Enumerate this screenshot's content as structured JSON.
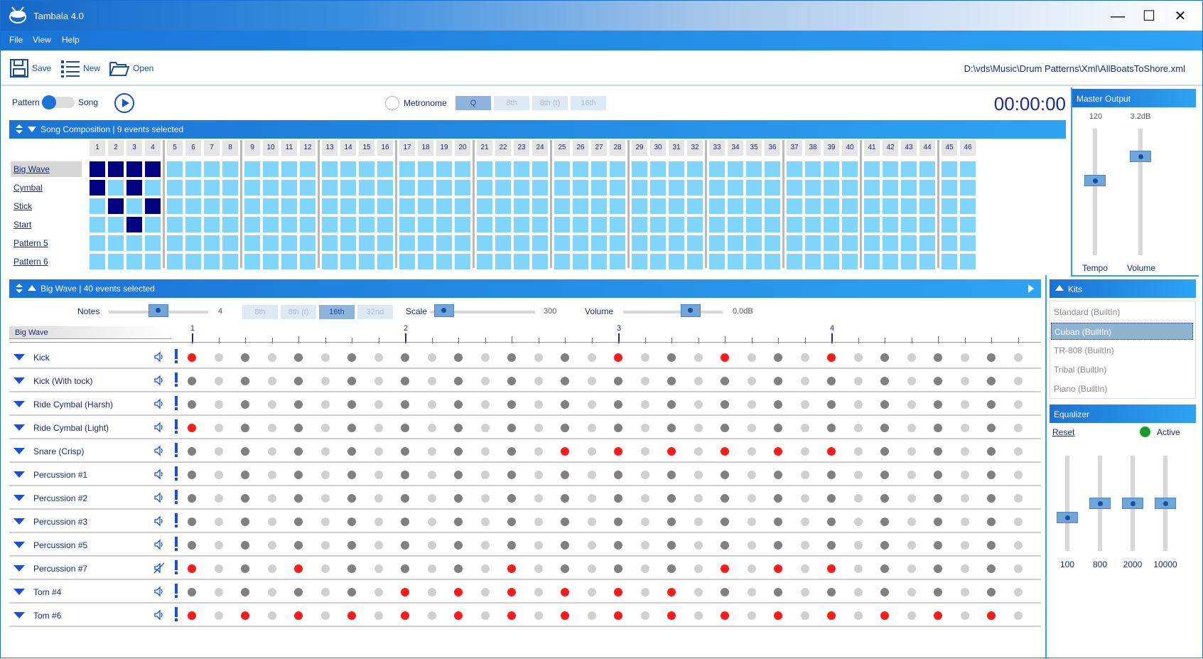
{
  "app": {
    "title": "Tambala 4.0"
  },
  "window_controls": {
    "minimize": "—",
    "maximize": "☐",
    "close": "✕"
  },
  "menu": [
    "File",
    "View",
    "Help"
  ],
  "toolbar": {
    "save": "Save",
    "new": "New",
    "open": "Open",
    "filepath": "D:\\vds\\Music\\Drum Patterns\\Xml\\AllBoatsToShore.xml"
  },
  "transport": {
    "pattern_label": "Pattern",
    "song_label": "Song",
    "metronome_label": "Metronome",
    "metronome_options": [
      {
        "label": "Q",
        "active": true
      },
      {
        "label": "8th",
        "active": false
      },
      {
        "label": "8th (t)",
        "active": false
      },
      {
        "label": "16th",
        "active": false
      }
    ],
    "timer": "00:00:00"
  },
  "song": {
    "header": "Song Composition  |  9 events selected",
    "columns": [
      "1",
      "2",
      "3",
      "4",
      "5",
      "6",
      "7",
      "8",
      "9",
      "10",
      "11",
      "12",
      "13",
      "14",
      "15",
      "16",
      "17",
      "18",
      "19",
      "20",
      "21",
      "22",
      "23",
      "24",
      "25",
      "26",
      "27",
      "28",
      "29",
      "30",
      "31",
      "32",
      "33",
      "34",
      "35",
      "36",
      "37",
      "38",
      "39",
      "40",
      "41",
      "42",
      "43",
      "44",
      "45",
      "46"
    ],
    "patterns": [
      {
        "name": "Big Wave",
        "selected": true,
        "on": [
          0,
          1,
          2,
          3
        ]
      },
      {
        "name": "Cymbal",
        "selected": false,
        "on": [
          0,
          2
        ]
      },
      {
        "name": "Stick",
        "selected": false,
        "on": [
          1,
          3
        ]
      },
      {
        "name": "Start",
        "selected": false,
        "on": [
          2
        ]
      },
      {
        "name": "Pattern 5",
        "selected": false,
        "on": []
      },
      {
        "name": "Pattern 6",
        "selected": false,
        "on": []
      }
    ]
  },
  "master": {
    "header": "Master Output",
    "tempo_value": "120",
    "volume_value": "3.2dB",
    "tempo_label": "Tempo",
    "volume_label": "Volume",
    "tempo_level": 0.6,
    "volume_level": 0.81
  },
  "pattern_editor": {
    "header": "Big Wave  |  40 events selected",
    "notes_label": "Notes",
    "notes_value": "4",
    "notes_level": 0.5,
    "quant_options": [
      {
        "label": "8th",
        "active": false
      },
      {
        "label": "8th (t)",
        "active": false
      },
      {
        "label": "16th",
        "active": true
      },
      {
        "label": "32nd",
        "active": false
      }
    ],
    "scale_label": "Scale",
    "scale_value": "300",
    "scale_level": 0.05,
    "volume_label": "Volume",
    "volume_value": "0.0dB",
    "volume_level": 0.72,
    "pattern_name": "Big Wave",
    "bars": [
      "1",
      "2",
      "3",
      "4"
    ],
    "steps": 32,
    "instruments": [
      {
        "name": "Kick",
        "muted": false,
        "red": [
          0,
          16,
          20,
          24
        ]
      },
      {
        "name": "Kick (With tock)",
        "muted": false,
        "red": []
      },
      {
        "name": "Ride Cymbal (Harsh)",
        "muted": false,
        "red": []
      },
      {
        "name": "Ride Cymbal (Light)",
        "muted": false,
        "red": [
          0
        ]
      },
      {
        "name": "Snare (Crisp)",
        "muted": false,
        "red": [
          14,
          16,
          18,
          20,
          22,
          24
        ]
      },
      {
        "name": "Percussion #1",
        "muted": false,
        "red": []
      },
      {
        "name": "Percussion #2",
        "muted": false,
        "red": []
      },
      {
        "name": "Percussion #3",
        "muted": false,
        "red": []
      },
      {
        "name": "Percussion #5",
        "muted": false,
        "red": []
      },
      {
        "name": "Percussion #7",
        "muted": true,
        "red": [
          0,
          4,
          12,
          20,
          22,
          24
        ]
      },
      {
        "name": "Tom #4",
        "muted": false,
        "red": [
          8,
          10,
          12,
          14,
          16,
          18
        ]
      },
      {
        "name": "Tom #6",
        "muted": false,
        "red": [
          0,
          2,
          4,
          6,
          8,
          10,
          12,
          14,
          16,
          18,
          20,
          22,
          24,
          26,
          28,
          30
        ]
      }
    ]
  },
  "kits": {
    "header": "Kits",
    "items": [
      {
        "name": "Standard (BuiltIn)",
        "selected": false
      },
      {
        "name": "Cuban (BuiltIn)",
        "selected": true
      },
      {
        "name": "TR-808 (BuiltIn)",
        "selected": false
      },
      {
        "name": "Tribal (BuiltIn)",
        "selected": false
      },
      {
        "name": "Piano (BuiltIn)",
        "selected": false
      }
    ]
  },
  "equalizer": {
    "header": "Equalizer",
    "reset_label": "Reset",
    "active_label": "Active",
    "active_color": "#1a9c2a",
    "bands": [
      {
        "label": "100",
        "level": 0.33
      },
      {
        "label": "800",
        "level": 0.5
      },
      {
        "label": "2000",
        "level": 0.5
      },
      {
        "label": "10000",
        "level": 0.5
      }
    ]
  }
}
